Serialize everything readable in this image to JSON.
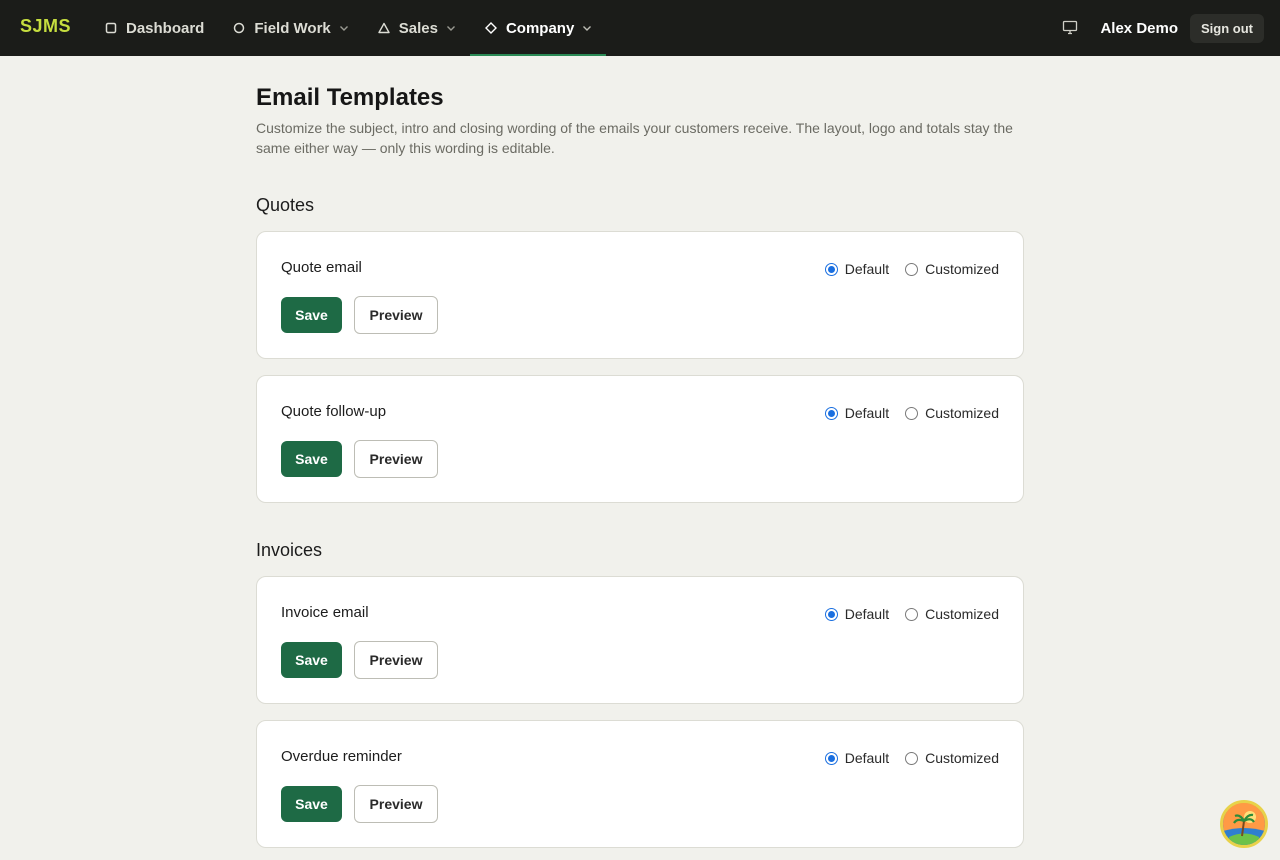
{
  "brand": "SJMS",
  "nav": {
    "items": [
      {
        "label": "Dashboard",
        "icon": "square-icon"
      },
      {
        "label": "Field Work",
        "icon": "circle-icon"
      },
      {
        "label": "Sales",
        "icon": "triangle-icon"
      },
      {
        "label": "Company",
        "icon": "diamond-icon",
        "active": true
      }
    ],
    "user_name": "Alex Demo",
    "signout_label": "Sign out"
  },
  "page": {
    "title": "Email Templates",
    "description": "Customize the subject, intro and closing wording of the emails your customers receive. The layout, logo and totals stay the same either way — only this wording is editable."
  },
  "sections": [
    {
      "title": "Quotes",
      "templates": [
        {
          "name": "Quote email",
          "selected": "Default"
        },
        {
          "name": "Quote follow-up",
          "selected": "Default"
        }
      ]
    },
    {
      "title": "Invoices",
      "templates": [
        {
          "name": "Invoice email",
          "selected": "Default"
        },
        {
          "name": "Overdue reminder",
          "selected": "Default"
        }
      ]
    }
  ],
  "options": {
    "default": "Default",
    "customized": "Customized"
  },
  "buttons": {
    "save": "Save",
    "preview": "Preview"
  },
  "colors": {
    "brand": "#c6de3f",
    "nav_bg": "#1b1c19",
    "primary": "#1e6a45",
    "radio_accent": "#1a6fe0",
    "page_bg": "#f1f1ec"
  }
}
